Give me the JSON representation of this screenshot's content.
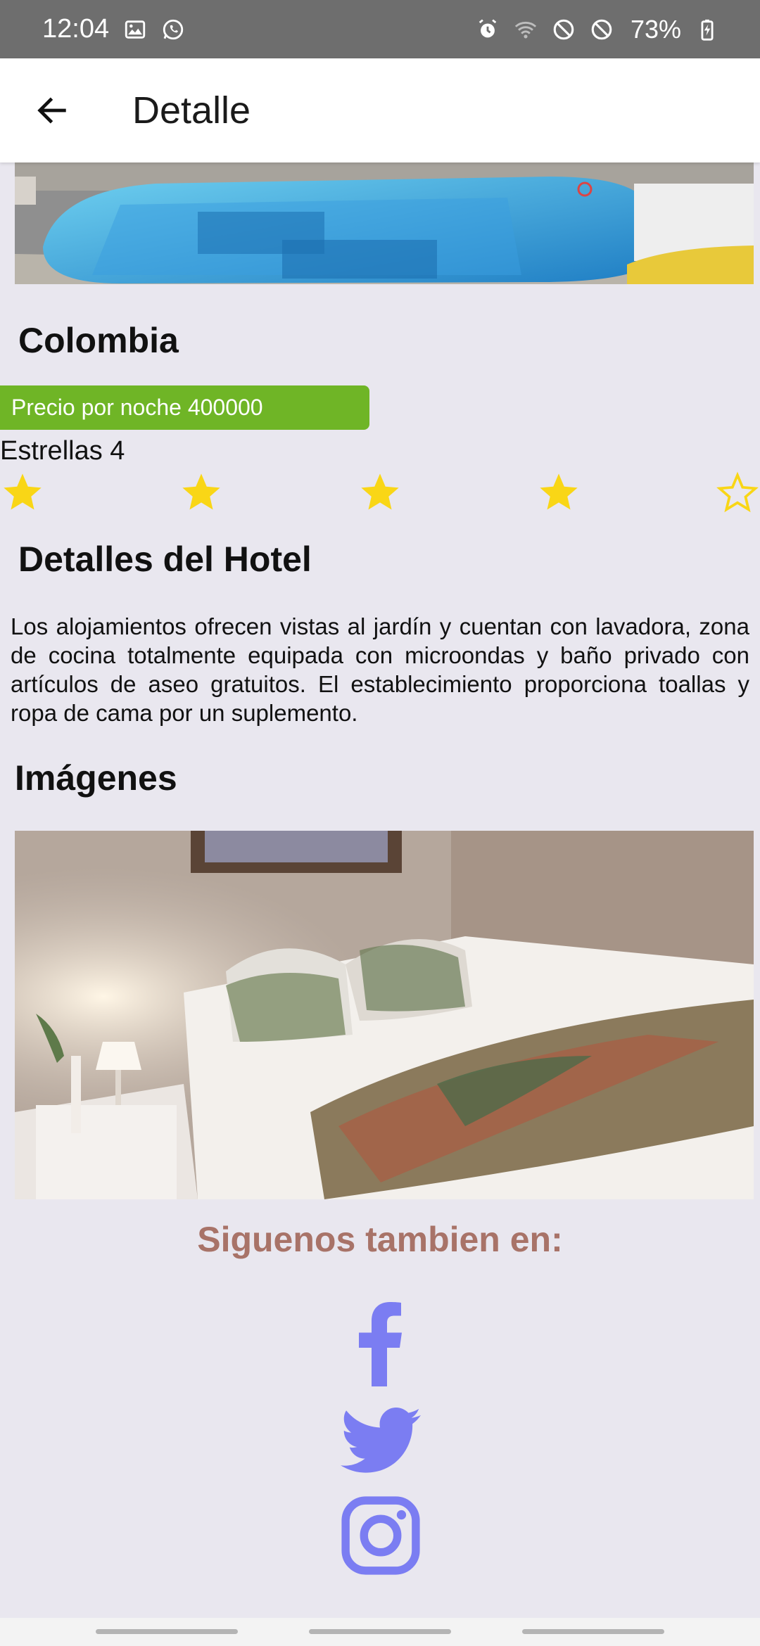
{
  "status_bar": {
    "time": "12:04",
    "battery": "73%",
    "left_icons": [
      "image-icon",
      "whatsapp-icon"
    ],
    "right_icons": [
      "alarm-icon",
      "wifi-icon",
      "do-not-disturb-icon",
      "do-not-disturb-icon",
      "battery-charging-icon"
    ]
  },
  "app_bar": {
    "title": "Detalle",
    "back_icon": "arrow-left-icon"
  },
  "hotel": {
    "name": "Colombia",
    "price_text": "Precio por noche 400000",
    "stars_text": "Estrellas 4",
    "rating": 4,
    "rating_max": 5,
    "details_title": "Detalles del Hotel",
    "details": "Los alojamientos ofrecen vistas al jardín y cuentan con lavadora, zona de cocina totalmente equipada con microondas y baño privado con artículos de aseo gratuitos. El establecimiento proporciona toallas y ropa de cama por un suplemento.",
    "images_title": "Imágenes"
  },
  "footer": {
    "follow_text": "Siguenos tambien en:",
    "social": [
      "facebook-icon",
      "twitter-icon",
      "instagram-icon"
    ]
  },
  "colors": {
    "price_badge": "#6fb526",
    "star": "#f9d616",
    "follow_text": "#a87368",
    "social_icon": "#7b7df2"
  }
}
